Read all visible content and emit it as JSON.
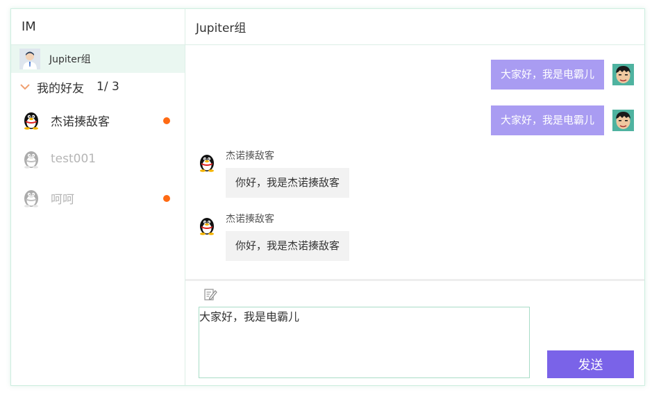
{
  "app": {
    "title": "IM"
  },
  "sidebar": {
    "group": {
      "name": "Jupiter组"
    },
    "friends_header": {
      "label": "我的好友",
      "count": "1/ 3"
    },
    "friends": [
      {
        "name": "杰诺揍敌客",
        "status": "online",
        "unread": true
      },
      {
        "name": "test001",
        "status": "offline",
        "unread": false
      },
      {
        "name": "呵呵",
        "status": "offline",
        "unread": true
      }
    ]
  },
  "chat": {
    "title": "Jupiter组",
    "messages": [
      {
        "from": "self",
        "text": "大家好，我是电霸儿"
      },
      {
        "from": "self",
        "text": "大家好，我是电霸儿"
      },
      {
        "from": "other",
        "sender": "杰诺揍敌客",
        "text": "你好，我是杰诺揍敌客"
      },
      {
        "from": "other",
        "sender": "杰诺揍敌客",
        "text": "你好，我是杰诺揍敌客"
      }
    ]
  },
  "composer": {
    "input_value": "大家好，我是电霸儿",
    "send_label": "发送"
  },
  "colors": {
    "accent": "#7a63e8",
    "self_bubble": "#a99cf2",
    "other_bubble": "#f2f2f2",
    "unread_dot": "#ff6a13",
    "selected_row": "#eaf7f1",
    "border": "#cdeee0"
  },
  "icons": {
    "collapse": "chevron-down-icon",
    "compose": "edit-icon",
    "avatar_group": "user-avatar-icon",
    "avatar_friend": "penguin-avatar-icon",
    "avatar_self": "cartoon-face-avatar-icon"
  }
}
